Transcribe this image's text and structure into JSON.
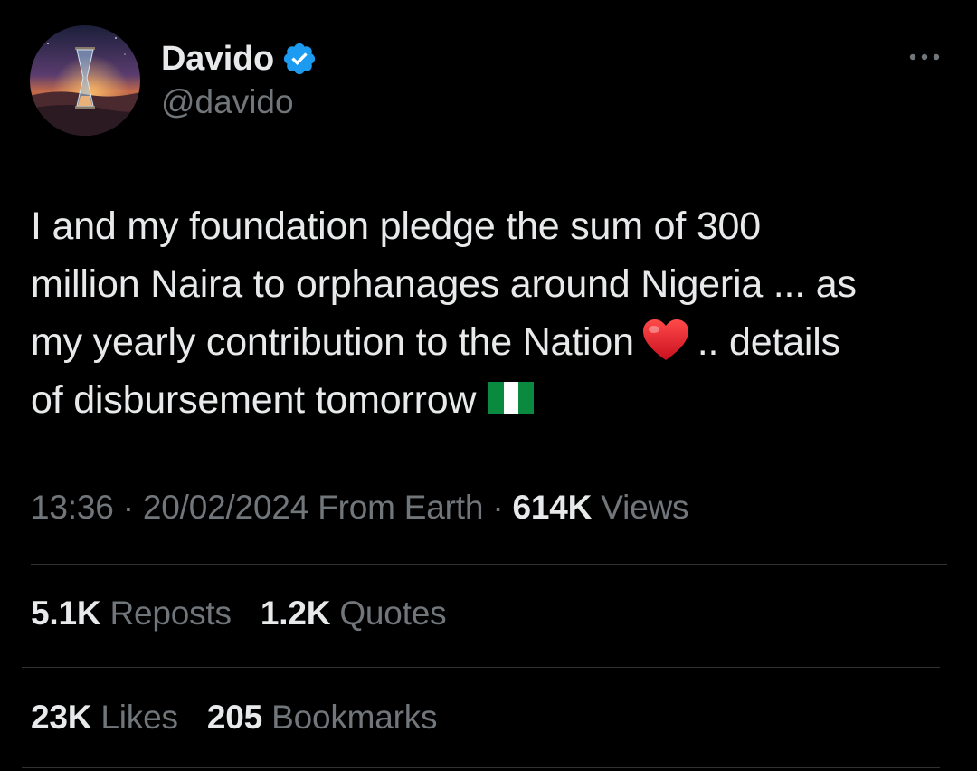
{
  "author": {
    "display_name": "Davido",
    "handle": "@davido",
    "verified": true,
    "avatar_icon": "hourglass-desert-avatar"
  },
  "tweet": {
    "lines": [
      "I and my foundation pledge the sum of 300",
      "million Naira  to orphanages around Nigeria ... as",
      "my yearly contribution to the Nation",
      ".. details",
      "of disbursement tomorrow"
    ],
    "emojis": [
      "red-heart-emoji",
      "nigeria-flag-emoji"
    ]
  },
  "meta": {
    "time": "13:36",
    "separator": "·",
    "date": "20/02/2024",
    "source": "From Earth",
    "views_count": "614K",
    "views_label": "Views"
  },
  "stats": {
    "reposts_count": "5.1K",
    "reposts_label": "Reposts",
    "quotes_count": "1.2K",
    "quotes_label": "Quotes",
    "likes_count": "23K",
    "likes_label": "Likes",
    "bookmarks_count": "205",
    "bookmarks_label": "Bookmarks"
  },
  "colors": {
    "background": "#000000",
    "text_primary": "#e7e9ea",
    "text_secondary": "#71767b",
    "verified_blue": "#1d9bf0",
    "divider": "#2f3336"
  }
}
